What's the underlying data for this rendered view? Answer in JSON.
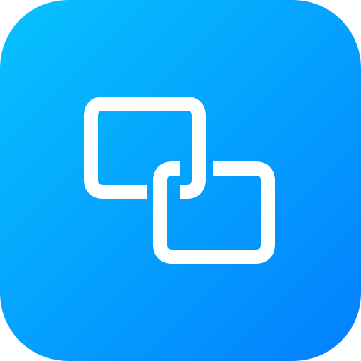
{
  "icon": {
    "name": "link-icon",
    "gradient_start": "#07C2FE",
    "gradient_end": "#0380FE",
    "glyph_color": "#FFFFFF"
  }
}
